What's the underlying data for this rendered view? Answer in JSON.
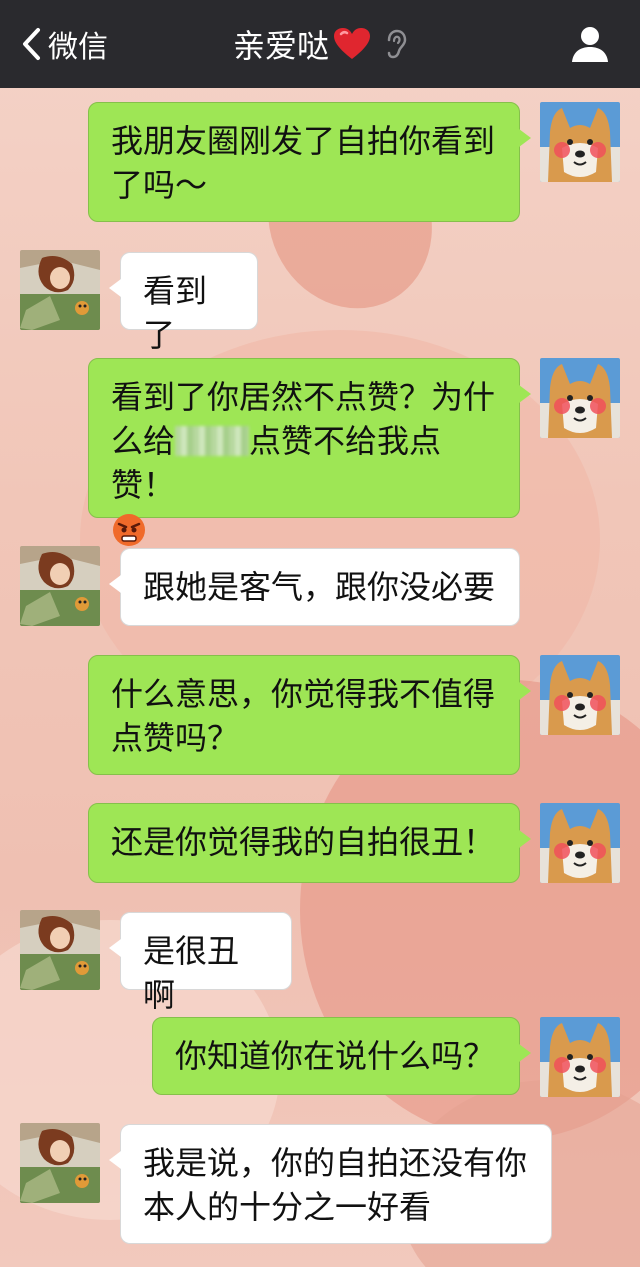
{
  "nav": {
    "back_label": "微信",
    "contact_name": "亲爱哒",
    "heart_icon": "red-heart",
    "ear_icon": "ear",
    "profile_icon": "person"
  },
  "colors": {
    "nav_bg": "#2a2a2e",
    "bubble_sent": "#9ee655",
    "bubble_received": "#ffffff",
    "heart": "#e0262f"
  },
  "messages": [
    {
      "from": "me",
      "text": "我朋友圈刚发了自拍你看到了吗～"
    },
    {
      "from": "her",
      "text": "看到了"
    },
    {
      "from": "me",
      "part1": "看到了你居然不点赞？为什么给",
      "part2": "点赞不给我点赞！",
      "emoji": "angry-face"
    },
    {
      "from": "her",
      "text": "跟她是客气，跟你没必要"
    },
    {
      "from": "me",
      "text": "什么意思，你觉得我不值得点赞吗？"
    },
    {
      "from": "me",
      "text": "还是你觉得我的自拍很丑！"
    },
    {
      "from": "her",
      "text": "是很丑啊"
    },
    {
      "from": "me",
      "text": "你知道你在说什么吗？"
    },
    {
      "from": "her",
      "text": "我是说，你的自拍还没有你本人的十分之一好看"
    }
  ]
}
